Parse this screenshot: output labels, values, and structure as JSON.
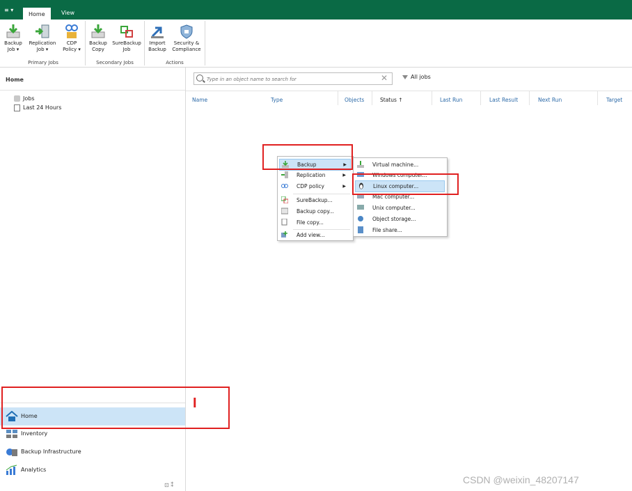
{
  "menu": {
    "label": "≡ ▾"
  },
  "tabs": [
    {
      "label": "Home"
    },
    {
      "label": "View"
    }
  ],
  "ribbon": {
    "buttons": [
      {
        "line1": "Backup",
        "line2": "Job ▾"
      },
      {
        "line1": "Replication",
        "line2": "Job ▾"
      },
      {
        "line1": "CDP",
        "line2": "Policy ▾"
      },
      {
        "line1": "Backup",
        "line2": "Copy"
      },
      {
        "line1": "SureBackup",
        "line2": "Job"
      },
      {
        "line1": "Import",
        "line2": "Backup"
      },
      {
        "line1": "Security &",
        "line2": "Compliance"
      }
    ],
    "groups": [
      "Primary Jobs",
      "Secondary Jobs",
      "Actions"
    ]
  },
  "left": {
    "title": "Home",
    "tree": [
      "Jobs",
      "Last 24 Hours"
    ],
    "nav": [
      "Home",
      "Inventory",
      "Backup Infrastructure",
      "Analytics"
    ],
    "bottom_icons": "⊡ ⁑"
  },
  "search": {
    "placeholder": "Type in an object name to search for",
    "clear": "✕"
  },
  "filter": {
    "label": "All jobs"
  },
  "columns": [
    "Name",
    "Type",
    "Objects",
    "Status ↑",
    "Last Run",
    "Last Result",
    "Next Run",
    "Target"
  ],
  "context_menu": {
    "items": [
      "Backup",
      "Replication",
      "CDP policy",
      "SureBackup...",
      "Backup copy...",
      "File copy...",
      "Add view..."
    ],
    "arrow": "▶"
  },
  "submenu": {
    "items": [
      "Virtual machine...",
      "Windows computer...",
      "Linux computer...",
      "Mac computer...",
      "Unix computer...",
      "Object storage...",
      "File share..."
    ]
  },
  "annotation": {
    "cursor_mark": "I"
  },
  "watermark": "CSDN @weixin_48207147",
  "colors": {
    "tabbar": "#0a6a45",
    "selection": "#cce4f7",
    "annotation": "#e02020"
  }
}
